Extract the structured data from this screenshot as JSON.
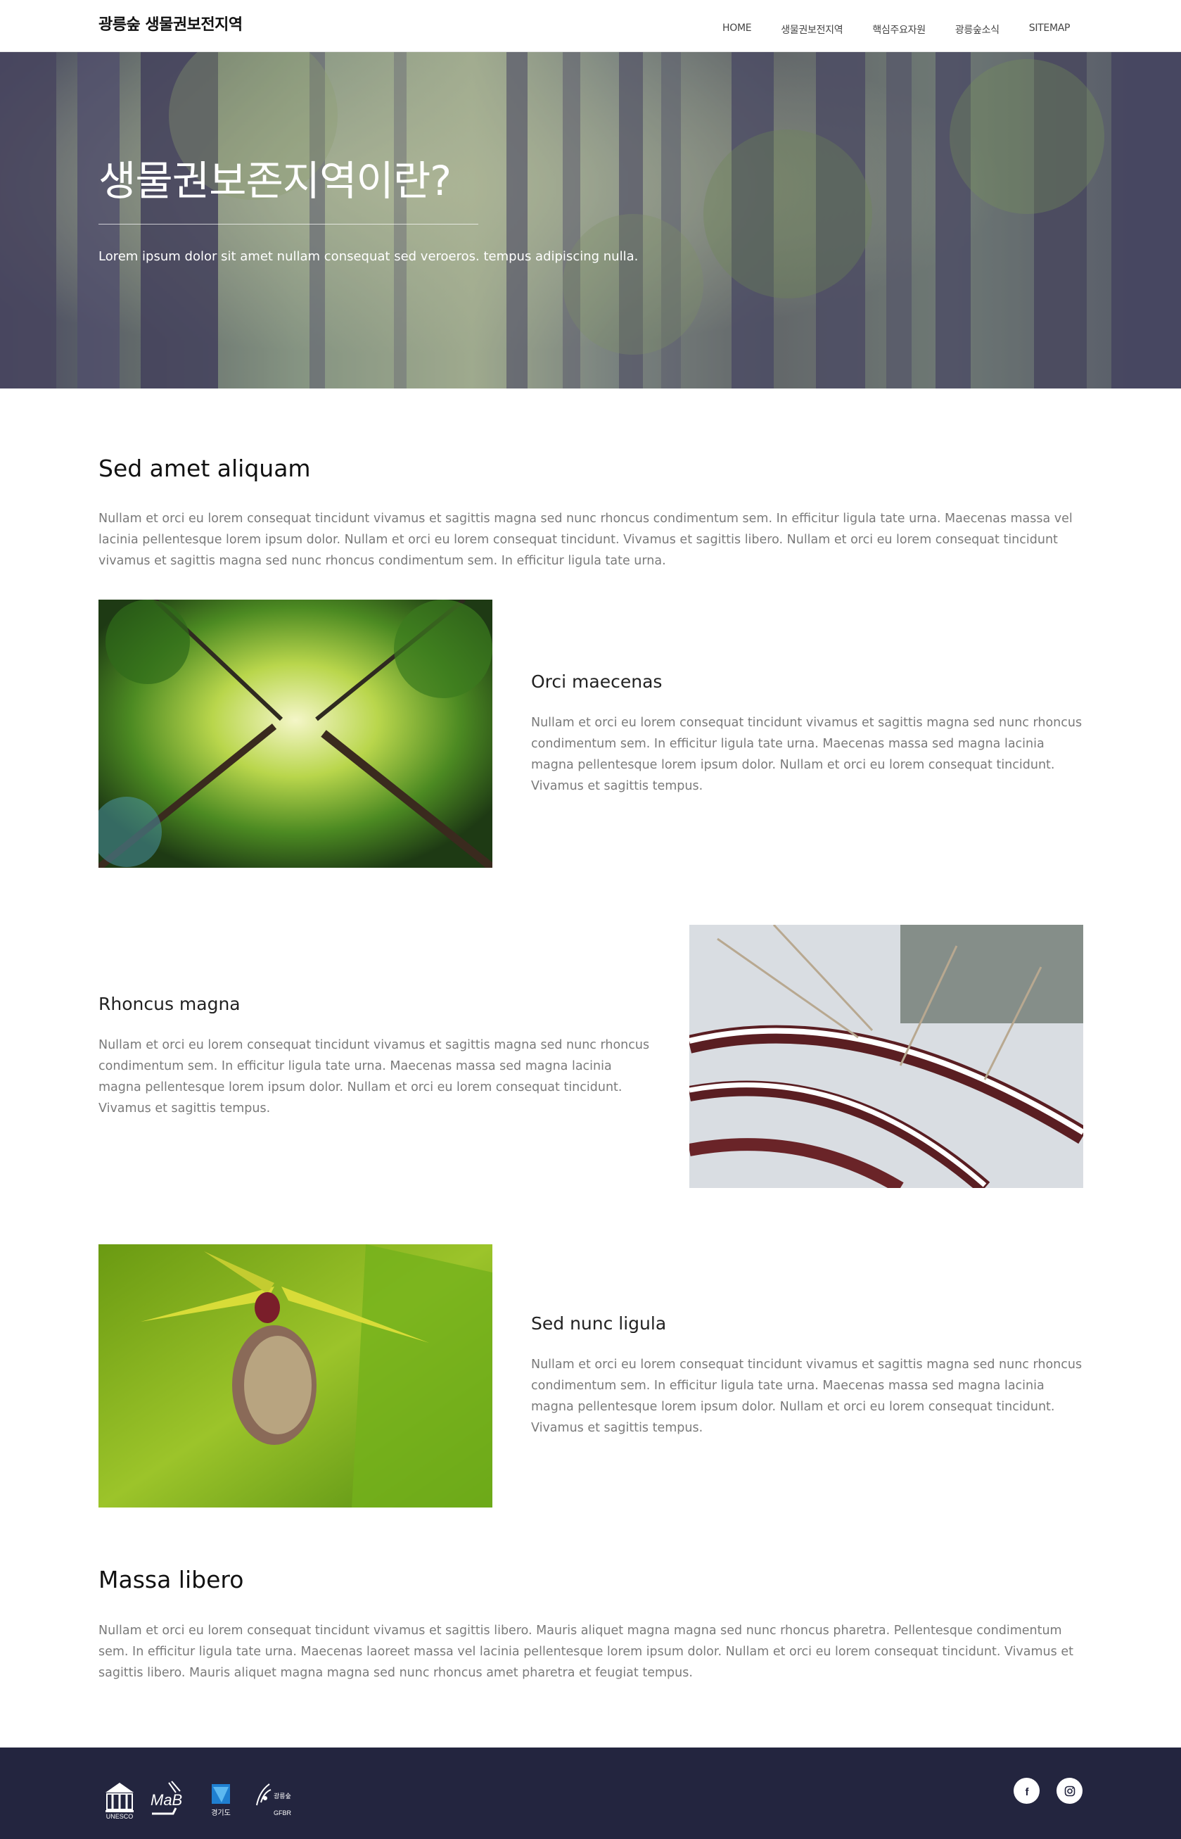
{
  "header": {
    "logo": "광릉숲 생물권보전지역",
    "nav": [
      "HOME",
      "생물권보전지역",
      "핵심주요자원",
      "광릉숲소식",
      "SITEMAP"
    ]
  },
  "hero": {
    "title": "생물권보존지역이란?",
    "subtitle": "Lorem ipsum dolor sit amet nullam consequat sed veroeros. tempus adipiscing nulla."
  },
  "intro": {
    "heading": "Sed amet aliquam",
    "text": "Nullam et orci eu lorem consequat tincidunt vivamus et sagittis magna sed nunc rhoncus condimentum sem. In efficitur ligula tate urna. Maecenas massa vel lacinia pellentesque lorem ipsum dolor. Nullam et orci eu lorem consequat tincidunt. Vivamus et sagittis libero. Nullam et orci eu lorem consequat tincidunt vivamus et sagittis magna sed nunc rhoncus condimentum sem. In efficitur ligula tate urna."
  },
  "features": [
    {
      "heading": "Orci maecenas",
      "text": "Nullam et orci eu lorem consequat tincidunt vivamus et sagittis magna sed nunc rhoncus condimentum sem. In efficitur ligula tate urna. Maecenas massa sed magna lacinia magna pellentesque lorem ipsum dolor. Nullam et orci eu lorem consequat tincidunt. Vivamus et sagittis tempus.",
      "image": "forest-canopy-photo"
    },
    {
      "heading": "Rhoncus magna",
      "text": "Nullam et orci eu lorem consequat tincidunt vivamus et sagittis magna sed nunc rhoncus condimentum sem. In efficitur ligula tate urna. Maecenas massa sed magna lacinia magna pellentesque lorem ipsum dolor. Nullam et orci eu lorem consequat tincidunt. Vivamus et sagittis tempus.",
      "image": "snowy-branches-photo"
    },
    {
      "heading": "Sed nunc ligula",
      "text": "Nullam et orci eu lorem consequat tincidunt vivamus et sagittis magna sed nunc rhoncus condimentum sem. In efficitur ligula tate urna. Maecenas massa sed magna lacinia magna pellentesque lorem ipsum dolor. Nullam et orci eu lorem consequat tincidunt. Vivamus et sagittis tempus.",
      "image": "orchid-flower-photo"
    }
  ],
  "closing": {
    "heading": "Massa libero",
    "text": "Nullam et orci eu lorem consequat tincidunt vivamus et sagittis libero. Mauris aliquet magna magna sed nunc rhoncus pharetra. Pellentesque condimentum sem. In efficitur ligula tate urna. Maecenas laoreet massa vel lacinia pellentesque lorem ipsum dolor. Nullam et orci eu lorem consequat tincidunt. Vivamus et sagittis libero. Mauris aliquet magna magna sed nunc rhoncus amet pharetra et feugiat tempus."
  },
  "footer": {
    "partners": [
      "UNESCO",
      "MAB",
      "경기도",
      "광릉숲 생물권보전지역 GFBR"
    ],
    "social": [
      "facebook-icon",
      "instagram-icon"
    ],
    "colors": {
      "background": "#23253f"
    }
  }
}
